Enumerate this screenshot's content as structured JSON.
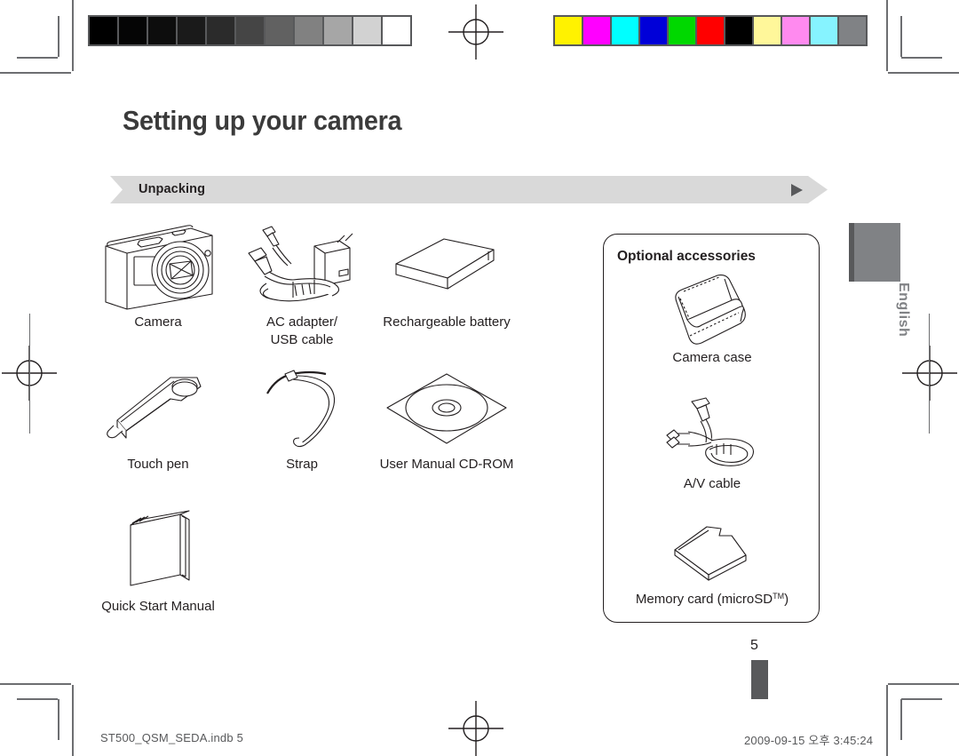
{
  "page": {
    "title": "Setting up your camera",
    "section_label": "Unpacking",
    "language_tab": "English",
    "page_number": "5"
  },
  "calibration": {
    "grayscale_swatches": [
      "#000000",
      "#050505",
      "#0d0d0d",
      "#1a1a1a",
      "#2b2b2b",
      "#454545",
      "#616161",
      "#818181",
      "#a6a6a6",
      "#d2d2d2",
      "#ffffff"
    ],
    "color_swatches": [
      "#fff200",
      "#ff00ff",
      "#00ffff",
      "#0000d8",
      "#00d800",
      "#ff0000",
      "#000000",
      "#fff79a",
      "#ff8aef",
      "#86f3ff",
      "#808285"
    ]
  },
  "unpacking_items": [
    {
      "icon": "camera-icon",
      "caption": "Camera"
    },
    {
      "icon": "ac-adapter-usb-cable-icon",
      "caption": "AC adapter/\nUSB cable",
      "caption_line1": "AC adapter/",
      "caption_line2": "USB cable"
    },
    {
      "icon": "rechargeable-battery-icon",
      "caption": "Rechargeable battery"
    },
    {
      "icon": "touch-pen-icon",
      "caption": "Touch pen"
    },
    {
      "icon": "strap-icon",
      "caption": "Strap"
    },
    {
      "icon": "cd-rom-icon",
      "caption": "User Manual CD-ROM"
    },
    {
      "icon": "quick-start-manual-icon",
      "caption": "Quick Start Manual"
    }
  ],
  "optional_accessories": {
    "title": "Optional accessories",
    "items": [
      {
        "icon": "camera-case-icon",
        "caption": "Camera case"
      },
      {
        "icon": "av-cable-icon",
        "caption": "A/V cable"
      },
      {
        "icon": "memory-card-icon",
        "caption_prefix": "Memory card (microSD",
        "caption_tm": "TM",
        "caption_suffix": ")"
      }
    ]
  },
  "footer": {
    "file_name": "ST500_QSM_SEDA.indb   5",
    "timestamp": "2009-09-15   오후 3:45:24"
  },
  "colors": {
    "banner_bg": "#d9d9d9",
    "banner_arrow": "#58595b",
    "tab_gray": "#808285",
    "tab_dark": "#58595b",
    "ink": "#231f20"
  }
}
